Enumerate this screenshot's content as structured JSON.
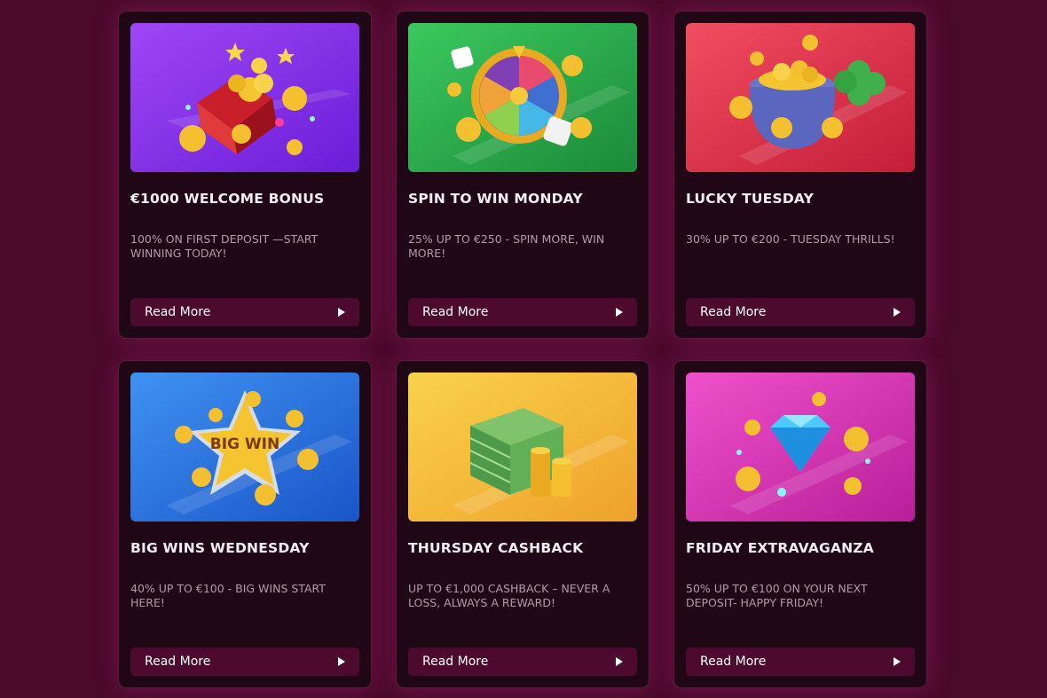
{
  "promotions": [
    {
      "title": "€1000 WELCOME BONUS",
      "description": "100% ON FIRST DEPOSIT —START WINNING TODAY!",
      "button_label": "Read More",
      "art": {
        "icon": "treasure-chest-icon",
        "bg_from": "#9b3cf0",
        "bg_to": "#6a1ed8"
      }
    },
    {
      "title": "SPIN TO WIN MONDAY",
      "description": "25% UP TO €250 - SPIN MORE, WIN MORE!",
      "button_label": "Read More",
      "art": {
        "icon": "prize-wheel-icon",
        "bg_from": "#34c25a",
        "bg_to": "#1c8a3a"
      }
    },
    {
      "title": "LUCKY TUESDAY",
      "description": "30% UP TO €200 - TUESDAY THRILLS!",
      "button_label": "Read More",
      "art": {
        "icon": "pot-of-gold-icon",
        "bg_from": "#ef4a5e",
        "bg_to": "#c41d3a"
      }
    },
    {
      "title": "BIG WINS WEDNESDAY",
      "description": "40% UP TO €100 - BIG WINS START HERE!",
      "button_label": "Read More",
      "art": {
        "icon": "big-win-star-icon",
        "bg_from": "#3b8cf0",
        "bg_to": "#1a55c8",
        "badge_text": "BIG WIN"
      }
    },
    {
      "title": "THURSDAY CASHBACK",
      "description": "UP TO €1,000 CASHBACK – NEVER A LOSS, ALWAYS A REWARD!",
      "button_label": "Read More",
      "art": {
        "icon": "cash-stack-icon",
        "bg_from": "#f9cf45",
        "bg_to": "#eea12c"
      }
    },
    {
      "title": "FRIDAY EXTRAVAGANZA",
      "description": "50% UP TO €100 ON YOUR NEXT DEPOSIT- HAPPY FRIDAY!",
      "button_label": "Read More",
      "art": {
        "icon": "diamond-icon",
        "bg_from": "#ee4ec8",
        "bg_to": "#b81f9a"
      }
    }
  ],
  "colors": {
    "page_bg": "#4a0a2c",
    "card_bg": "#1f0715",
    "button_bg": "#4b0a2e",
    "title_text": "#f4eef2",
    "desc_text": "#b49aa8"
  }
}
